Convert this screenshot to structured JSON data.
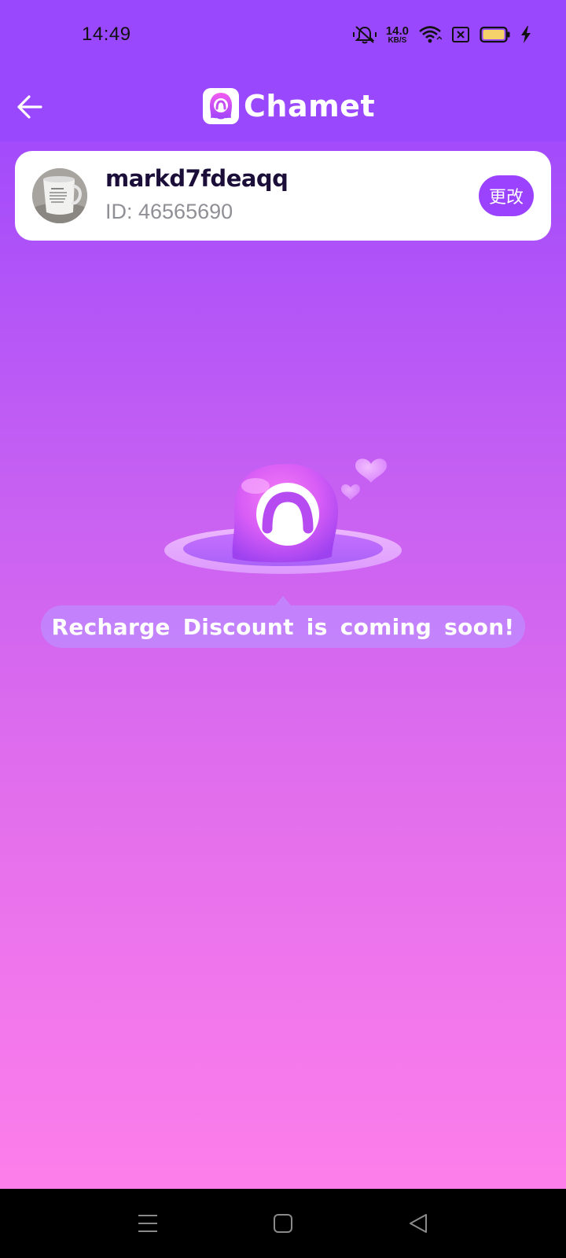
{
  "status_bar": {
    "time": "14:49",
    "net_speed_value": "14.0",
    "net_speed_unit": "KB/S",
    "icons": [
      "bell-off-icon",
      "net-speed",
      "wifi-icon",
      "sim-blocked-icon",
      "battery-icon",
      "charging-icon"
    ]
  },
  "header": {
    "back_icon": "arrow-left-icon",
    "app_name": "Chamet",
    "logo_icon": "chamet-logo-icon"
  },
  "account": {
    "username": "markd7fdeaqq",
    "id_text": "ID: 46565690",
    "change_label": "更改"
  },
  "empty_state": {
    "message": "Recharge Discount is coming soon!"
  },
  "nav_bar": {
    "buttons": [
      "menu-icon",
      "home-icon",
      "back-icon"
    ]
  },
  "colors": {
    "primary": "#9a48fe",
    "accent_button": "#9a42fd",
    "username_text": "#1b0f3a",
    "id_text": "#8f8f96"
  }
}
